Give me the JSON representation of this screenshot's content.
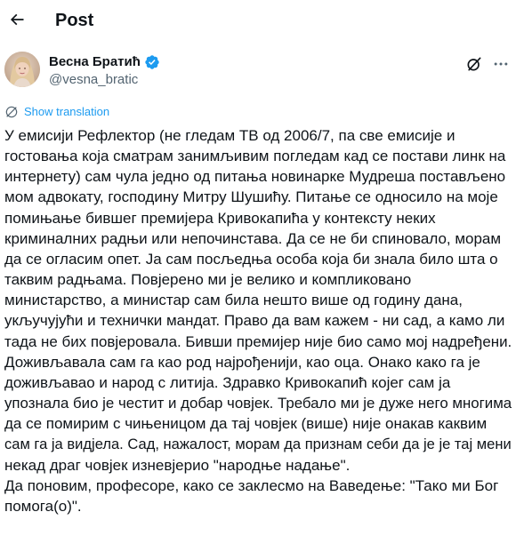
{
  "header": {
    "title": "Post",
    "back_icon": "arrow-left-icon"
  },
  "author": {
    "name": "Весна Братић",
    "handle": "@vesna_bratic",
    "verified": true,
    "verified_color": "#1d9bf0",
    "avatar": "avatar"
  },
  "actions": {
    "grok_icon": "grok-icon",
    "more_icon": "more-horizontal-icon"
  },
  "translation": {
    "label": "Show translation",
    "icon": "globe-icon",
    "color": "#1d9bf0"
  },
  "post": {
    "lines": [
      "У емисији Рефлектор (не гледам ТВ од 2006/7, па све емисије и",
      "гостовања која сматрам занимљивим погледам кад се постави линк на",
      "интернету) сам чула једно од питања новинарке Мудреша постављено",
      "мом адвокату, господину Митру Шушићу. Питање се односило на моје",
      "помињање бившег премијера Кривокапића у контексту неких",
      "криминалних радњи или непочинстава. Да се не би спиновало, морам",
      "да се огласим опет. Ја сам посљедња особа која би знала било шта о",
      "таквим радњама. Повјерено ми је велико и компликовано",
      "министарство, а министар сам била нешто више од годину дана,",
      "укључујући и технички мандат. Право да вам кажем - ни сад, а камо ли",
      "тада не бих повјеровала. Бивши премијер није био само мој надређени.",
      "Доживљавала сам га као род најрођенији, као оца. Онако како га је",
      "доживљавао и народ с литија. Здравко Кривокапић којег сам ја",
      "упознала био је честит и добар човјек. Требало ми је дуже него многима",
      "да се помирим с чињеницом да тај човјек (више) није онакав каквим",
      "сам га ја видјела. Сад, нажалост, морам да признам себи да је је тај мени",
      "некад драг човјек изневјерио \"народње надање\".",
      "Да поновим, професоре, како се заклесмо на Ваведење: \"Тако ми Бог",
      "помога(о)\"."
    ]
  }
}
